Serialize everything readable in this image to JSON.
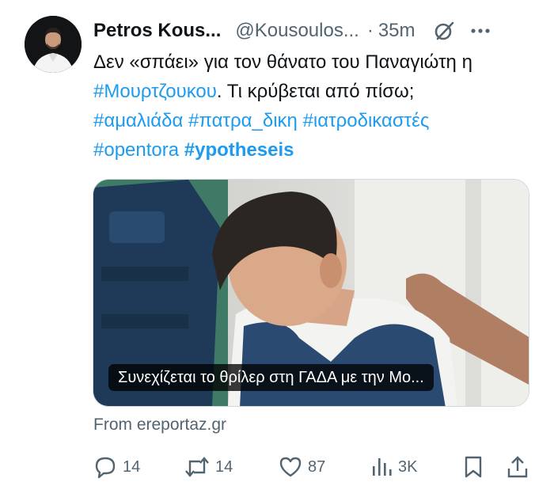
{
  "tweet": {
    "author_name": "Petros Kous...",
    "handle": "@Kousoulos...",
    "dot": "·",
    "time": "35m",
    "text_line1": "Δεν «σπάει» για τον θάνατο του Παναγιώτη η",
    "hashtag_1": "#Μουρτζουκου",
    "text_line2_rest": ". Τι κρύβεται από πίσω;",
    "hashtag_2": "#αμαλιάδα",
    "hashtag_3": "#πατρα_δικη",
    "hashtag_4": "#ιατροδικαστές",
    "hashtag_5": "#opentora",
    "hashtag_6": "#ypotheseis"
  },
  "card": {
    "caption": "Συνεχίζεται το θρίλερ στη ΓΑΔΑ με την Μο...",
    "source": "From ereportaz.gr"
  },
  "actions": {
    "replies": "14",
    "reposts": "14",
    "likes": "87",
    "views": "3K"
  },
  "icons": [
    "grok-icon",
    "more-icon",
    "reply-icon",
    "repost-icon",
    "like-icon",
    "views-icon",
    "bookmark-icon",
    "share-icon"
  ],
  "colors": {
    "link": "#1d9bf0",
    "muted": "#536471",
    "text": "#0f1419"
  }
}
